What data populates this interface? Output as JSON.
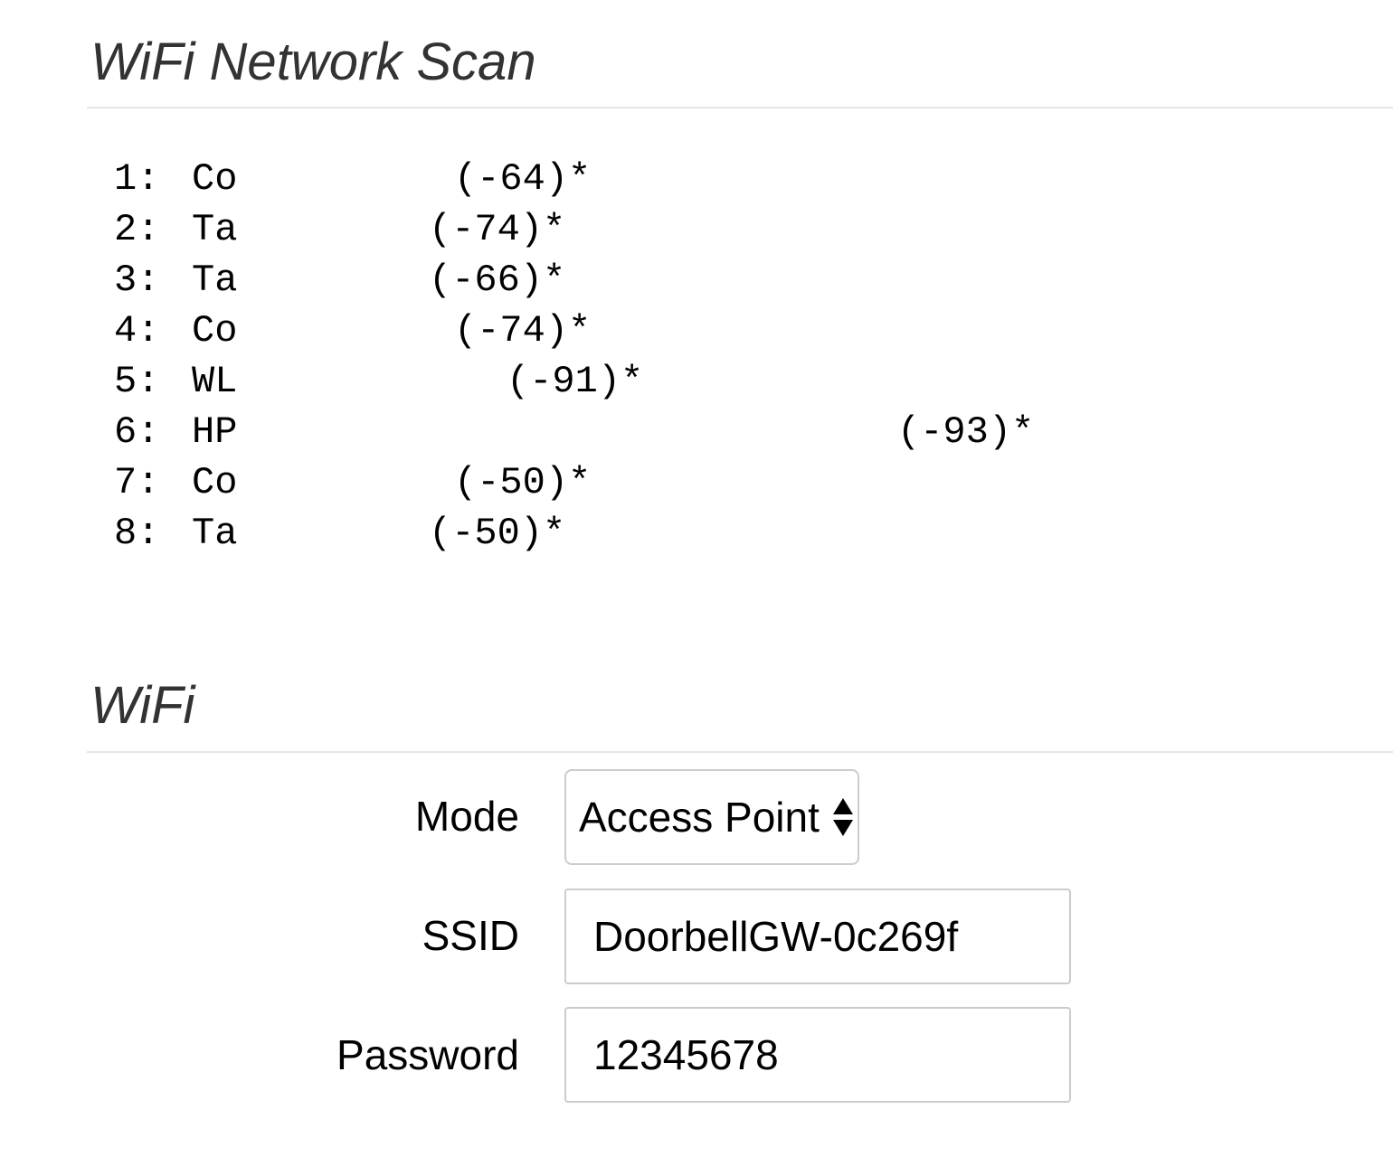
{
  "scan_section": {
    "title": "WiFi Network Scan",
    "networks": [
      {
        "index": "1:",
        "ssid": "Co",
        "rssi": "(-64)*"
      },
      {
        "index": "2:",
        "ssid": "Ta",
        "rssi": "(-74)*"
      },
      {
        "index": "3:",
        "ssid": "Ta",
        "rssi": "(-66)*"
      },
      {
        "index": "4:",
        "ssid": "Co",
        "rssi": "(-74)*"
      },
      {
        "index": "5:",
        "ssid": "WL",
        "rssi": "(-91)*"
      },
      {
        "index": "6:",
        "ssid": "HP",
        "rssi": "(-93)*"
      },
      {
        "index": "7:",
        "ssid": "Co",
        "rssi": "(-50)*"
      },
      {
        "index": "8:",
        "ssid": "Ta",
        "rssi": "(-50)*"
      }
    ]
  },
  "wifi_section": {
    "title": "WiFi",
    "mode": {
      "label": "Mode",
      "value": "Access Point"
    },
    "ssid": {
      "label": "SSID",
      "value": "DoorbellGW-0c269f"
    },
    "password": {
      "label": "Password",
      "value": "12345678"
    }
  }
}
